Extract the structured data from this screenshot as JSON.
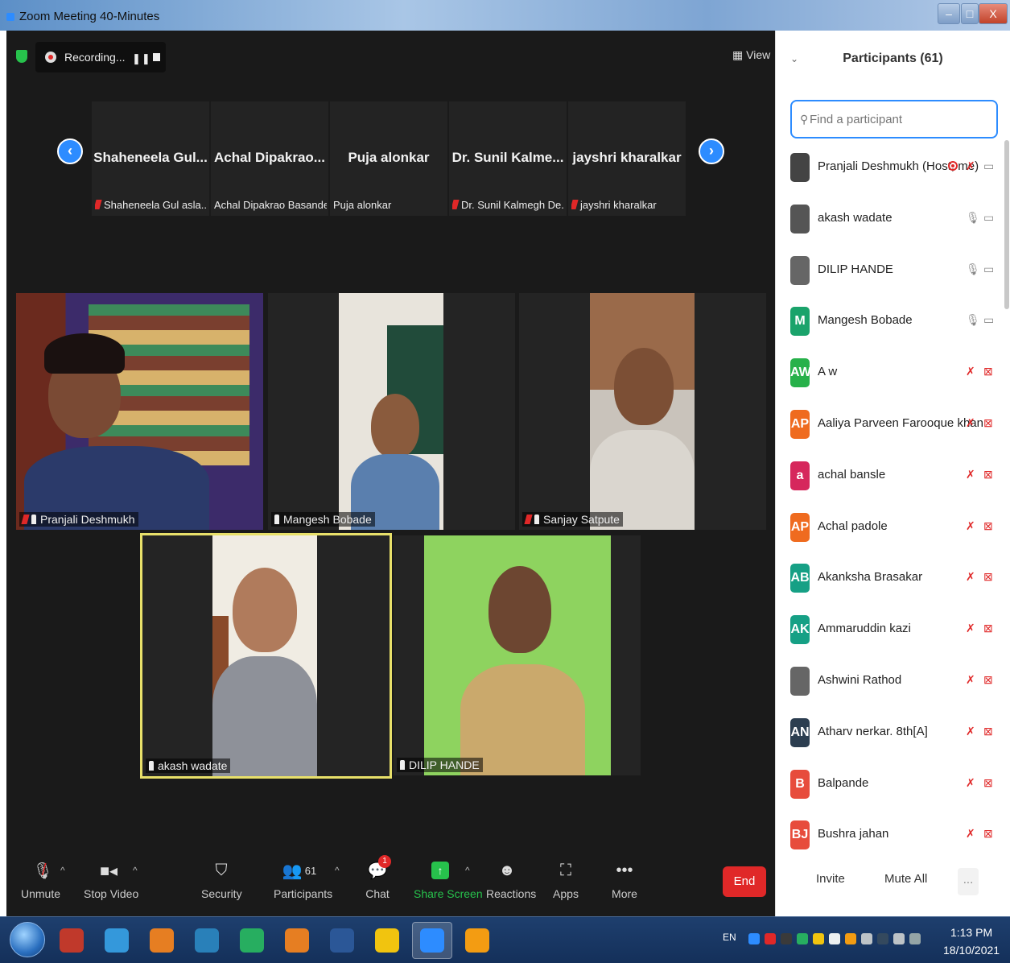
{
  "window": {
    "title": "Zoom Meeting 40-Minutes",
    "min": "–",
    "max": "□",
    "close": "X"
  },
  "meeting": {
    "recording_label": "Recording...",
    "view_label": "View",
    "filmstrip": [
      {
        "big": "Shaheneela Gul...",
        "small": "Shaheneela Gul asla...",
        "muted": true
      },
      {
        "big": "Achal Dipakrao...",
        "small": "Achal Dipakrao Basande",
        "muted": false
      },
      {
        "big": "Puja alonkar",
        "small": "Puja alonkar",
        "muted": false
      },
      {
        "big": "Dr. Sunil Kalme...",
        "small": "Dr. Sunil Kalmegh De...",
        "muted": true
      },
      {
        "big": "jayshri kharalkar",
        "small": "jayshri kharalkar",
        "muted": true
      }
    ],
    "tiles": [
      {
        "name": "Pranjali Deshmukh"
      },
      {
        "name": "Mangesh Bobade"
      },
      {
        "name": "Sanjay Satpute"
      },
      {
        "name": "akash wadate"
      },
      {
        "name": "DILIP HANDE"
      }
    ]
  },
  "toolbar": {
    "unmute": "Unmute",
    "stop_video": "Stop Video",
    "security": "Security",
    "participants_count": "61",
    "participants": "Participants",
    "chat": "Chat",
    "chat_badge": "1",
    "share_screen": "Share Screen",
    "reactions": "Reactions",
    "apps": "Apps",
    "more": "More",
    "end": "End"
  },
  "panel": {
    "title": "Participants (61)",
    "search_placeholder": "Find a participant",
    "invite": "Invite",
    "mute_all": "Mute All",
    "more": "...",
    "participants": [
      {
        "initials": "",
        "name": "Pranjali Deshmukh (Host, me)",
        "color": "#444444",
        "mic": "muted",
        "cam": "on",
        "recording": true
      },
      {
        "initials": "",
        "name": "akash wadate",
        "color": "#555555",
        "mic": "on",
        "cam": "on"
      },
      {
        "initials": "",
        "name": "DILIP HANDE",
        "color": "#666666",
        "mic": "on",
        "cam": "on"
      },
      {
        "initials": "M",
        "name": "Mangesh Bobade",
        "color": "#1aa36b",
        "mic": "on",
        "cam": "on"
      },
      {
        "initials": "AW",
        "name": "A w",
        "color": "#27b14a",
        "mic": "muted",
        "cam": "muted"
      },
      {
        "initials": "AP",
        "name": "Aaliya Parveen Farooque khan",
        "color": "#ef6b1f",
        "mic": "muted",
        "cam": "muted"
      },
      {
        "initials": "a",
        "name": "achal bansle",
        "color": "#d6275c",
        "mic": "muted",
        "cam": "muted"
      },
      {
        "initials": "AP",
        "name": "Achal padole",
        "color": "#ef6b1f",
        "mic": "muted",
        "cam": "muted"
      },
      {
        "initials": "AB",
        "name": "Akanksha Brasakar",
        "color": "#16a085",
        "mic": "muted",
        "cam": "muted"
      },
      {
        "initials": "AK",
        "name": "Ammaruddin kazi",
        "color": "#16a085",
        "mic": "muted",
        "cam": "muted"
      },
      {
        "initials": "",
        "name": "Ashwini Rathod",
        "color": "#666666",
        "mic": "muted",
        "cam": "muted"
      },
      {
        "initials": "AN",
        "name": "Atharv nerkar. 8th[A]",
        "color": "#2c3e50",
        "mic": "muted",
        "cam": "muted"
      },
      {
        "initials": "B",
        "name": "Balpande",
        "color": "#e74c3c",
        "mic": "muted",
        "cam": "muted"
      },
      {
        "initials": "BJ",
        "name": "Bushra jahan",
        "color": "#e74c3c",
        "mic": "muted",
        "cam": "muted"
      }
    ]
  },
  "taskbar": {
    "lang": "EN",
    "time": "1:13 PM",
    "date": "18/10/2021",
    "apps": [
      {
        "icon": "acrobat-icon",
        "color": "#c0392b"
      },
      {
        "icon": "internet-explorer-icon",
        "color": "#3498db"
      },
      {
        "icon": "media-player-icon",
        "color": "#e67e22"
      },
      {
        "icon": "edge-icon",
        "color": "#2980b9"
      },
      {
        "icon": "chrome-icon",
        "color": "#27ae60"
      },
      {
        "icon": "firefox-icon",
        "color": "#e67e22"
      },
      {
        "icon": "word-icon",
        "color": "#2b5797"
      },
      {
        "icon": "file-explorer-icon",
        "color": "#f1c40f"
      },
      {
        "icon": "zoom-icon",
        "color": "#2d8cff"
      },
      {
        "icon": "security-center-icon",
        "color": "#f39c12"
      }
    ]
  }
}
